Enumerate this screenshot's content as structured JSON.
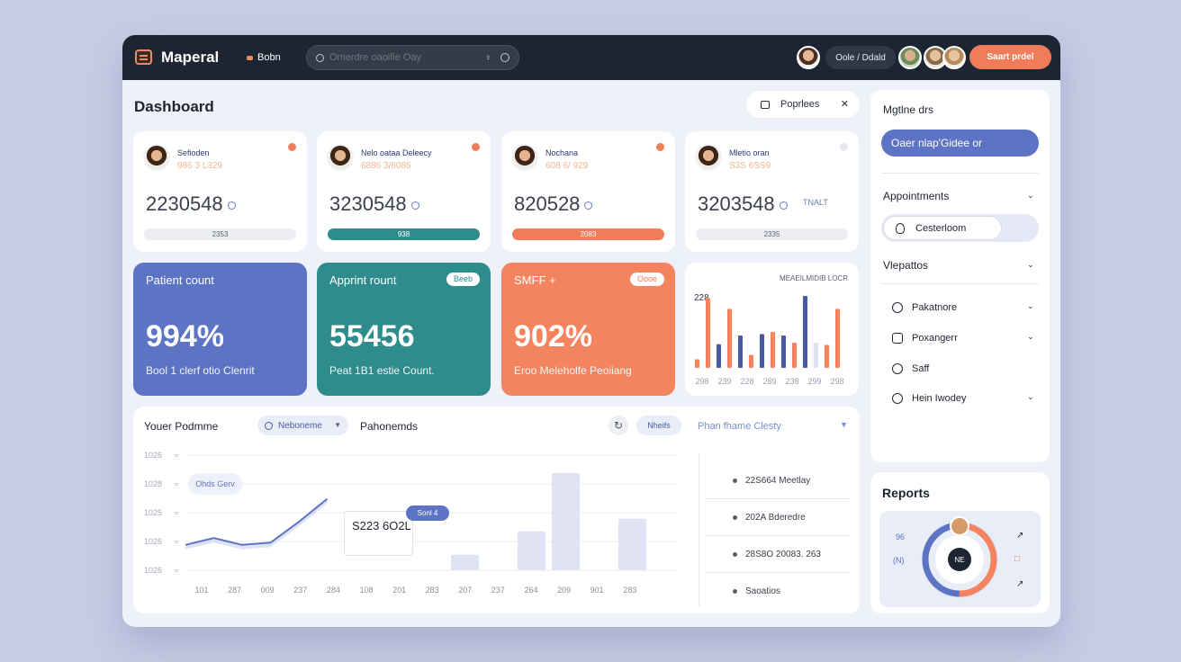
{
  "app": {
    "name": "Maperal",
    "top_link": "Bobn"
  },
  "search": {
    "placeholder": "Omerdre oaoifie Oay"
  },
  "header": {
    "user_pill": "Oole / Ddald",
    "start_button": "Saart prdel"
  },
  "page": {
    "title": "Dashboard",
    "filter_chip": "Poprlees"
  },
  "stat_cards": [
    {
      "name": "Sefioden",
      "sub": "986 3 L329",
      "value": "2230548",
      "extra": "",
      "bar_label": "2353",
      "bar_style": "grey",
      "dot": "orange"
    },
    {
      "name": "Nelo oataa Deleecy",
      "sub": "6886 3/6086",
      "value": "3230548",
      "extra": "",
      "bar_label": "938",
      "bar_style": "teal",
      "dot": "orange"
    },
    {
      "name": "Nochana",
      "sub": "608 6/ 929",
      "value": "820528",
      "extra": "",
      "bar_label": "2083",
      "bar_style": "orange",
      "dot": "orange"
    },
    {
      "name": "Mletio oran",
      "sub": "S3S 6SS9",
      "value": "3203548",
      "extra": "TNALT",
      "bar_label": "2335",
      "bar_style": "grey",
      "dot": "grey"
    }
  ],
  "color_cards": [
    {
      "label": "Patient count",
      "value": "994%",
      "desc": "Bool 1 clerf otio Clenrit",
      "badge": ""
    },
    {
      "label": "Apprint rount",
      "value": "55456",
      "desc": "Peat 1B1 estie Count.",
      "badge": "Beeb"
    },
    {
      "label": "SMFF +",
      "value": "902%",
      "desc": "Eroo Meleholfe Peoiiang",
      "badge": "Oooe"
    }
  ],
  "mini_chart": {
    "title": "MEAEILMIDIB LOCR",
    "ytop_label": "228",
    "x_labels": [
      "298",
      "239",
      "228",
      "289",
      "238",
      "299",
      "298"
    ],
    "bars": [
      {
        "color": "#f4845f",
        "value": 0.12
      },
      {
        "color": "#f4845f",
        "value": 0.97
      },
      {
        "color": "#4a5aa0",
        "value": 0.33
      },
      {
        "color": "#f4845f",
        "value": 0.82
      },
      {
        "color": "#4a5aa0",
        "value": 0.45
      },
      {
        "color": "#f4845f",
        "value": 0.18
      },
      {
        "color": "#4a5aa0",
        "value": 0.47
      },
      {
        "color": "#f4845f",
        "value": 0.5
      },
      {
        "color": "#4a5aa0",
        "value": 0.45
      },
      {
        "color": "#f4845f",
        "value": 0.35
      },
      {
        "color": "#4a5aa0",
        "value": 1.0
      },
      {
        "color": "#dfe3f0",
        "value": 0.35
      },
      {
        "color": "#f4845f",
        "value": 0.32
      },
      {
        "color": "#f4845f",
        "value": 0.82
      }
    ]
  },
  "bottom": {
    "title": "Youer Podmme",
    "dropdown": "Neboneme",
    "link": "Pahonemds",
    "pill": "Nheifs",
    "link2": "Phan fhame Clesty",
    "legend_chip": "Ohds Gerv",
    "tooltip": "S223 6O2L",
    "tooltip_tag": "Sonl 4",
    "y_labels": [
      "1026",
      "1028",
      "1025",
      "1026",
      "1026"
    ],
    "x_labels": [
      "101",
      "287",
      "009",
      "237",
      "284",
      "108",
      "201",
      "283",
      "207",
      "237",
      "264",
      "209",
      "901",
      "283"
    ],
    "line_points": [
      [
        0,
        0.22
      ],
      [
        1,
        0.28
      ],
      [
        2,
        0.22
      ],
      [
        3,
        0.24
      ],
      [
        4,
        0.42
      ],
      [
        5,
        0.62
      ]
    ],
    "col_bars": [
      0.16,
      0.4,
      1.0,
      0.53
    ],
    "list": [
      "22S664 Meetlay",
      "202A Bderedre",
      "28S8O 20083. 263",
      "Saoatios"
    ]
  },
  "right_panel": {
    "title": "Mgtlne drs",
    "button": "Oaer nlap'Gidee or",
    "section1": "Appointments",
    "toggle": "Cesterloom",
    "section2": "Vlepattos",
    "items": [
      "Pakatnore",
      "Poxangerr",
      "Saff",
      "Hein Iwodey"
    ]
  },
  "reports": {
    "title": "Reports",
    "center": "NE",
    "left_marks": [
      "96",
      "(N)"
    ],
    "right_marks": [
      "↗",
      "□",
      "↗",
      "↗"
    ],
    "donut": {
      "indigo": 0.52,
      "orange": 0.48
    }
  },
  "colors": {
    "indigo": "#5d73c4",
    "teal": "#2e8c8c",
    "orange": "#f4845f",
    "dark": "#1e2532"
  }
}
